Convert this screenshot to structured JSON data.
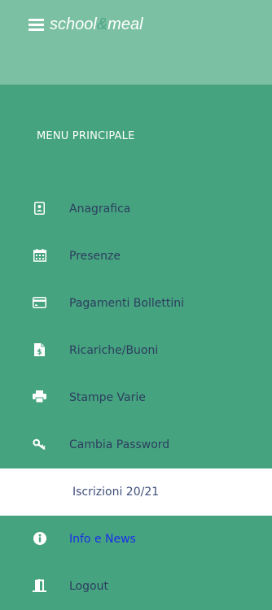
{
  "header": {
    "brand_school": "school",
    "brand_amp": "&",
    "brand_meal": "meal"
  },
  "menu": {
    "title": "MENU PRINCIPALE",
    "items": [
      {
        "label": "Anagrafica",
        "icon": "id-card-icon"
      },
      {
        "label": "Presenze",
        "icon": "calendar-icon"
      },
      {
        "label": "Pagamenti Bollettini",
        "icon": "credit-card-icon"
      },
      {
        "label": "Ricariche/Buoni",
        "icon": "invoice-dollar-icon"
      },
      {
        "label": "Stampe Varie",
        "icon": "printer-icon"
      },
      {
        "label": "Cambia Password",
        "icon": "key-icon"
      },
      {
        "label": "Iscrizioni 20/21",
        "icon": "",
        "active": true
      },
      {
        "label": "Info e News",
        "icon": "info-icon"
      },
      {
        "label": "Logout",
        "icon": "door-exit-icon"
      }
    ]
  },
  "colors": {
    "sidebar_bg": "#46a37f",
    "header_bg": "#7bc0a3",
    "text": "#2c3e60",
    "active_bg": "#ffffff",
    "link_text": "#1a2ee6"
  }
}
